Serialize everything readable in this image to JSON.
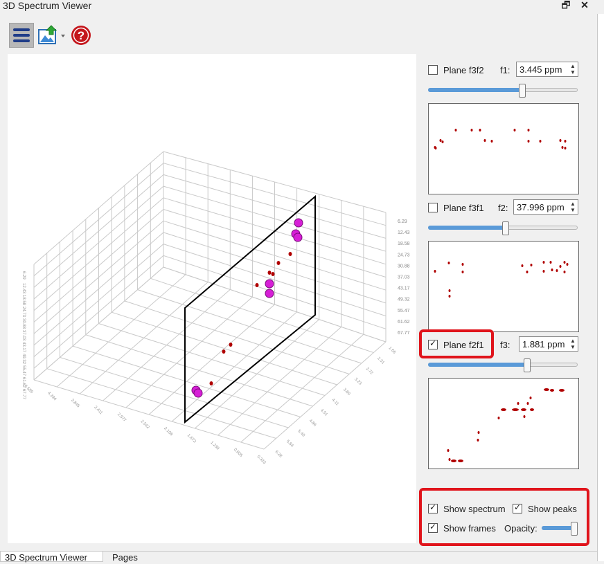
{
  "window": {
    "title": "3D Spectrum Viewer",
    "restore_glyph": "🗗",
    "close_glyph": "✕"
  },
  "toolbar": {
    "menu_icon": "hamburger-menu-icon",
    "export_icon": "export-image-icon",
    "help_icon": "help-icon"
  },
  "view3d": {
    "y_axis_ticks": [
      "6.29",
      "12.43",
      "18.58",
      "24.73",
      "30.88",
      "37.03",
      "43.17",
      "49.32",
      "55.47",
      "61.62",
      "67.77"
    ],
    "left_axis_ticks": [
      "6.29",
      "12.43",
      "18.58",
      "24.73",
      "30.88",
      "37.03",
      "43.17",
      "49.32",
      "55.47",
      "61.62",
      "67.77"
    ],
    "right_axis_ticks": [
      "1.66",
      "2.31",
      "2.72",
      "3.23",
      "3.69",
      "4.11",
      "4.51",
      "4.86",
      "5.40",
      "5.84",
      "6.28"
    ],
    "bottom_axis_ticks": [
      "4.585",
      "4.394",
      "3.845",
      "3.411",
      "2.977",
      "2.542",
      "2.108",
      "1.673",
      "1.239",
      "0.805",
      "0.333"
    ],
    "peak_color": "#d61fd6",
    "contour_color": "#b00000"
  },
  "planes": [
    {
      "label": "Plane f3f2",
      "checked": false,
      "axis_label": "f1:",
      "value": "3.445 ppm",
      "slider_fraction": 0.63
    },
    {
      "label": "Plane f3f1",
      "checked": false,
      "axis_label": "f2:",
      "value": "37.996 ppm",
      "slider_fraction": 0.52
    },
    {
      "label": "Plane f2f1",
      "checked": true,
      "axis_label": "f3:",
      "value": "1.881 ppm",
      "slider_fraction": 0.66
    }
  ],
  "options": {
    "show_spectrum": "Show spectrum",
    "show_peaks": "Show peaks",
    "show_frames": "Show frames",
    "opacity_label": "Opacity:",
    "opacity_fraction": 0.95
  },
  "tabs": [
    "3D Spectrum Viewer",
    "Pages"
  ],
  "colors": {
    "highlight": "#e0141b",
    "slider_fill": "#5a9ad8",
    "help_red": "#c4161c",
    "menu_blue": "#1f3c88"
  }
}
